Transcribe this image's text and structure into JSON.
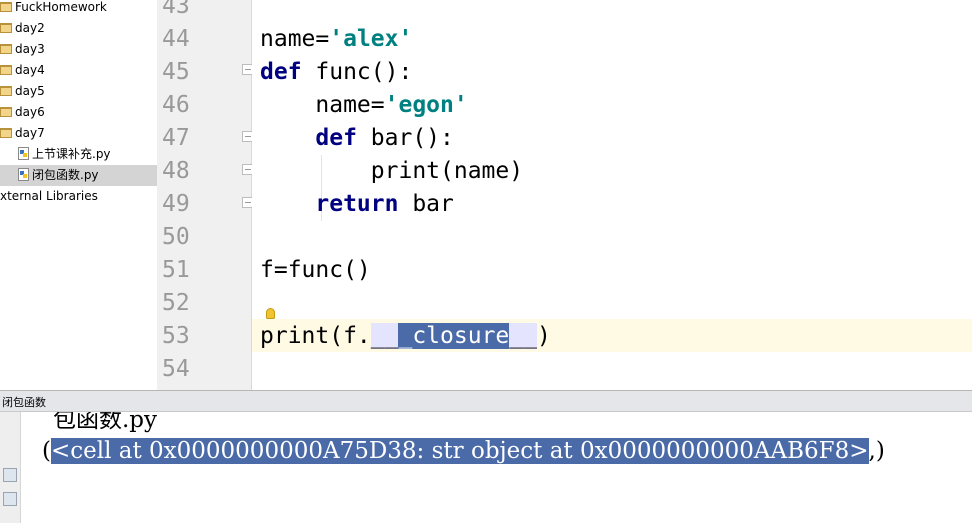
{
  "sidebar": {
    "items": [
      {
        "label": "FuckHomework",
        "type": "folder"
      },
      {
        "label": "day2",
        "type": "folder"
      },
      {
        "label": "day3",
        "type": "folder"
      },
      {
        "label": "day4",
        "type": "folder"
      },
      {
        "label": "day5",
        "type": "folder"
      },
      {
        "label": "day6",
        "type": "folder"
      },
      {
        "label": "day7",
        "type": "folder"
      },
      {
        "label": "上节课补充.py",
        "type": "file"
      },
      {
        "label": "闭包函数.py",
        "type": "file",
        "selected": true
      },
      {
        "label": "xternal Libraries",
        "type": "library"
      }
    ]
  },
  "editor": {
    "line_numbers": [
      "43",
      "44",
      "45",
      "46",
      "47",
      "48",
      "49",
      "50",
      "51",
      "52",
      "53",
      "54"
    ],
    "lines": {
      "l44": {
        "a": "name=",
        "b": "'alex'"
      },
      "l45": {
        "a": "def",
        "b": " func():"
      },
      "l46": {
        "a": "    name=",
        "b": "'egon'"
      },
      "l47": {
        "a": "    ",
        "b": "def",
        "c": " bar():"
      },
      "l48": {
        "a": "        print(name)"
      },
      "l49": {
        "a": "    ",
        "b": "return",
        "c": " bar"
      },
      "l51": {
        "a": "f=func()"
      },
      "l53": {
        "a": "print(f.",
        "b": "__",
        "c": "_closure",
        "d": "__",
        "e": ")"
      }
    },
    "icons": [
      "lightbulb-icon",
      "fold-marker-icon"
    ]
  },
  "run_panel": {
    "title": "闭包函数",
    "output_partial": "包函数.py",
    "output_prefix": "(",
    "output_selected": "<cell at 0x0000000000A75D38: str object at 0x0000000000AAB6F8>",
    "output_suffix": ",)",
    "colors": {
      "selection": "#4a6aa8",
      "keyword": "#000080",
      "string": "#008080"
    }
  }
}
